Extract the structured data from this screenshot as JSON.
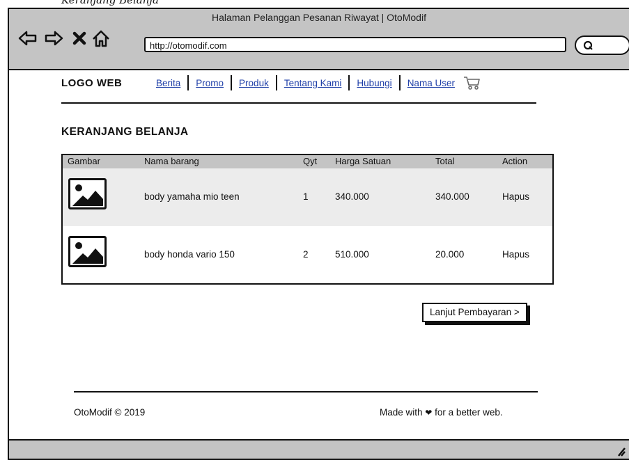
{
  "caption": "Keranjang Belanja",
  "window": {
    "title": "Halaman Pelanggan Pesanan Riwayat | OtoModif",
    "url": "http://otomodif.com"
  },
  "header": {
    "logo": "LOGO WEB",
    "nav": [
      "Berita",
      "Promo",
      "Produk",
      "Tentang Kami",
      "Hubungi",
      "Nama User"
    ]
  },
  "page": {
    "title": "KERANJANG BELANJA"
  },
  "table": {
    "columns": [
      "Gambar",
      "Nama barang",
      "Qyt",
      "Harga Satuan",
      "Total",
      "Action"
    ],
    "rows": [
      {
        "name": "body yamaha mio teen",
        "qty": "1",
        "price": "340.000",
        "total": "340.000",
        "action": "Hapus"
      },
      {
        "name": "body honda vario 150",
        "qty": "2",
        "price": "510.000",
        "total": "20.000",
        "action": "Hapus"
      }
    ]
  },
  "actions": {
    "continue_payment": "Lanjut Pembayaran >"
  },
  "footer": {
    "copyright": "OtoModif © 2019",
    "made_with_prefix": "Made with",
    "made_with_suffix": "for a better web."
  },
  "icons": {
    "back": "back-arrow-icon",
    "forward": "forward-arrow-icon",
    "stop": "close-icon",
    "home": "home-icon",
    "search": "search-icon",
    "cart": "cart-icon",
    "image": "image-placeholder-icon",
    "heart": "heart-icon"
  }
}
